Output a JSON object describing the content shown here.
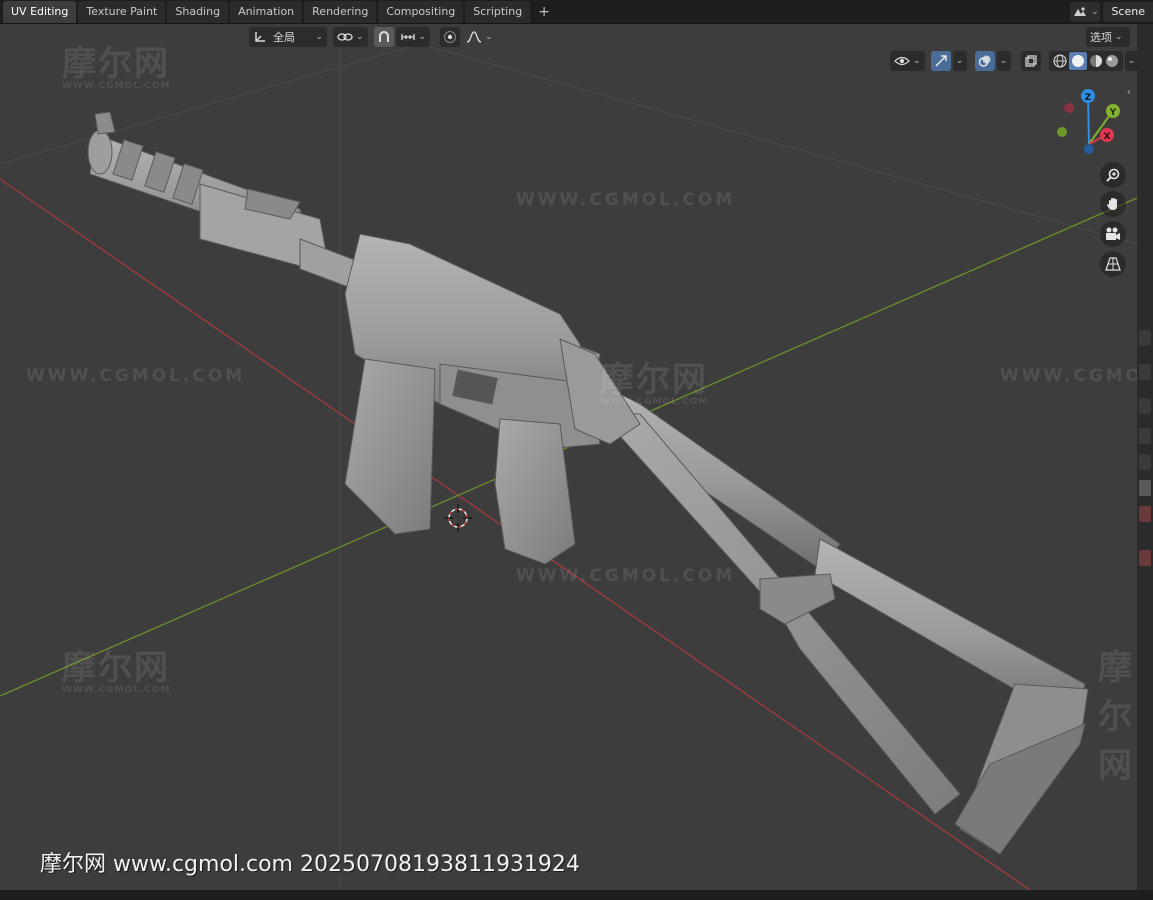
{
  "workspace_tabs": [
    "UV Editing",
    "Texture Paint",
    "Shading",
    "Animation",
    "Rendering",
    "Compositing",
    "Scripting"
  ],
  "add_tab_label": "+",
  "scene": {
    "label": "Scene"
  },
  "header": {
    "transform_orientation": "全局",
    "options_label": "选项"
  },
  "gizmo": {
    "z": "Z",
    "y": "Y",
    "x": "X"
  },
  "watermark": {
    "cn": "摩尔网",
    "url_small": "WWW.CGMOL.COM",
    "url_large": "WWW.CGMOL.COM"
  },
  "caption": "摩尔网 www.cgmol.com 20250708193811931924",
  "colors": {
    "x_axis": "#a43b3b",
    "y_axis": "#6a8f2a",
    "gizmo_x": "#e0384f",
    "gizmo_y": "#83b130",
    "gizmo_z": "#2e8fe6",
    "model": "#9a9a9a",
    "active_tab": "#3d3d3d"
  }
}
